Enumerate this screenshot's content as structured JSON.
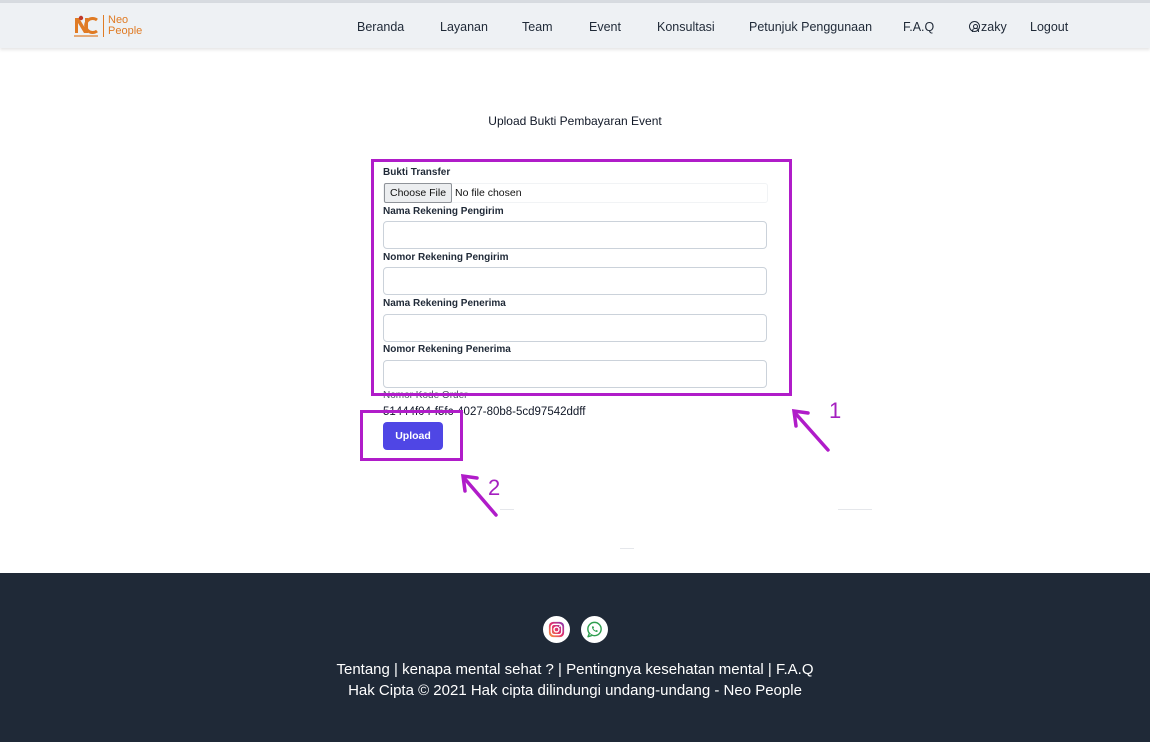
{
  "brand": {
    "line1": "Neo",
    "line2": "People",
    "tagline": "PEOPLE"
  },
  "nav": {
    "items": [
      "Beranda",
      "Layanan",
      "Team",
      "Event",
      "Konsultasi",
      "Petunjuk Penggunaan",
      "F.A.Q"
    ],
    "user": "zaky",
    "logout": "Logout"
  },
  "page": {
    "title": "Upload Bukti Pembayaran Event"
  },
  "form": {
    "bukti_label": "Bukti Transfer",
    "file_button": "Choose File",
    "file_status": "No file chosen",
    "fields": [
      {
        "label": "Nama Rekening Pengirim",
        "value": ""
      },
      {
        "label": "Nomor Rekening Pengirim",
        "value": ""
      },
      {
        "label": "Nama Rekening Penerima",
        "value": ""
      },
      {
        "label": "Nomor Rekening Penerima",
        "value": ""
      }
    ],
    "order_label": "Nomor Kode Order",
    "order_value": "51444f04-f5fc-4027-80b8-5cd97542ddff",
    "upload_label": "Upload"
  },
  "annotations": {
    "first": "1",
    "second": "2",
    "color": "#b01cc9"
  },
  "footer": {
    "links": [
      "Tentang",
      "kenapa mental sehat ?",
      "Pentingnya kesehatan mental",
      "F.A.Q"
    ],
    "separator": " | ",
    "copyright": "Hak Cipta © 2021 Hak cipta dilindungi undang-undang - Neo People",
    "socials": [
      "instagram-icon",
      "whatsapp-icon"
    ]
  },
  "colors": {
    "brand": "#e07b24",
    "primary": "#4f46e5",
    "footer_bg": "#1f2937",
    "navbar_bg": "#eef1f4"
  }
}
